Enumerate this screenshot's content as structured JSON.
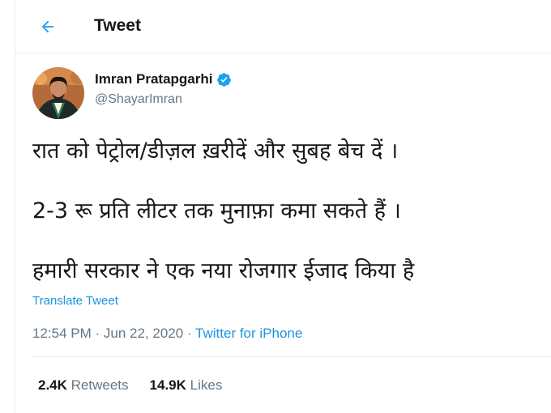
{
  "header": {
    "title": "Tweet",
    "back_icon": "arrow-left-icon"
  },
  "author": {
    "name": "Imran Pratapgarhi",
    "handle": "@ShayarImran",
    "verified": true,
    "verified_color": "#1da1f2"
  },
  "tweet": {
    "lines": [
      "रात को पेट्रोल/डीज़ल ख़रीदें और सुबह बेच दें ।",
      "2-3 रू प्रति लीटर तक मुनाफ़ा कमा सकते हैं ।",
      "हमारी सरकार ने एक नया रोजगार ईजाद किया है"
    ],
    "translate_label": "Translate Tweet",
    "time": "12:54 PM",
    "date": "Jun 22, 2020",
    "separator": "·",
    "source": "Twitter for iPhone"
  },
  "stats": {
    "retweets_count": "2.4K",
    "retweets_label": "Retweets",
    "likes_count": "14.9K",
    "likes_label": "Likes"
  },
  "colors": {
    "accent": "#1da1f2",
    "link": "#1b95e0",
    "muted": "#657786",
    "text": "#14171a"
  }
}
